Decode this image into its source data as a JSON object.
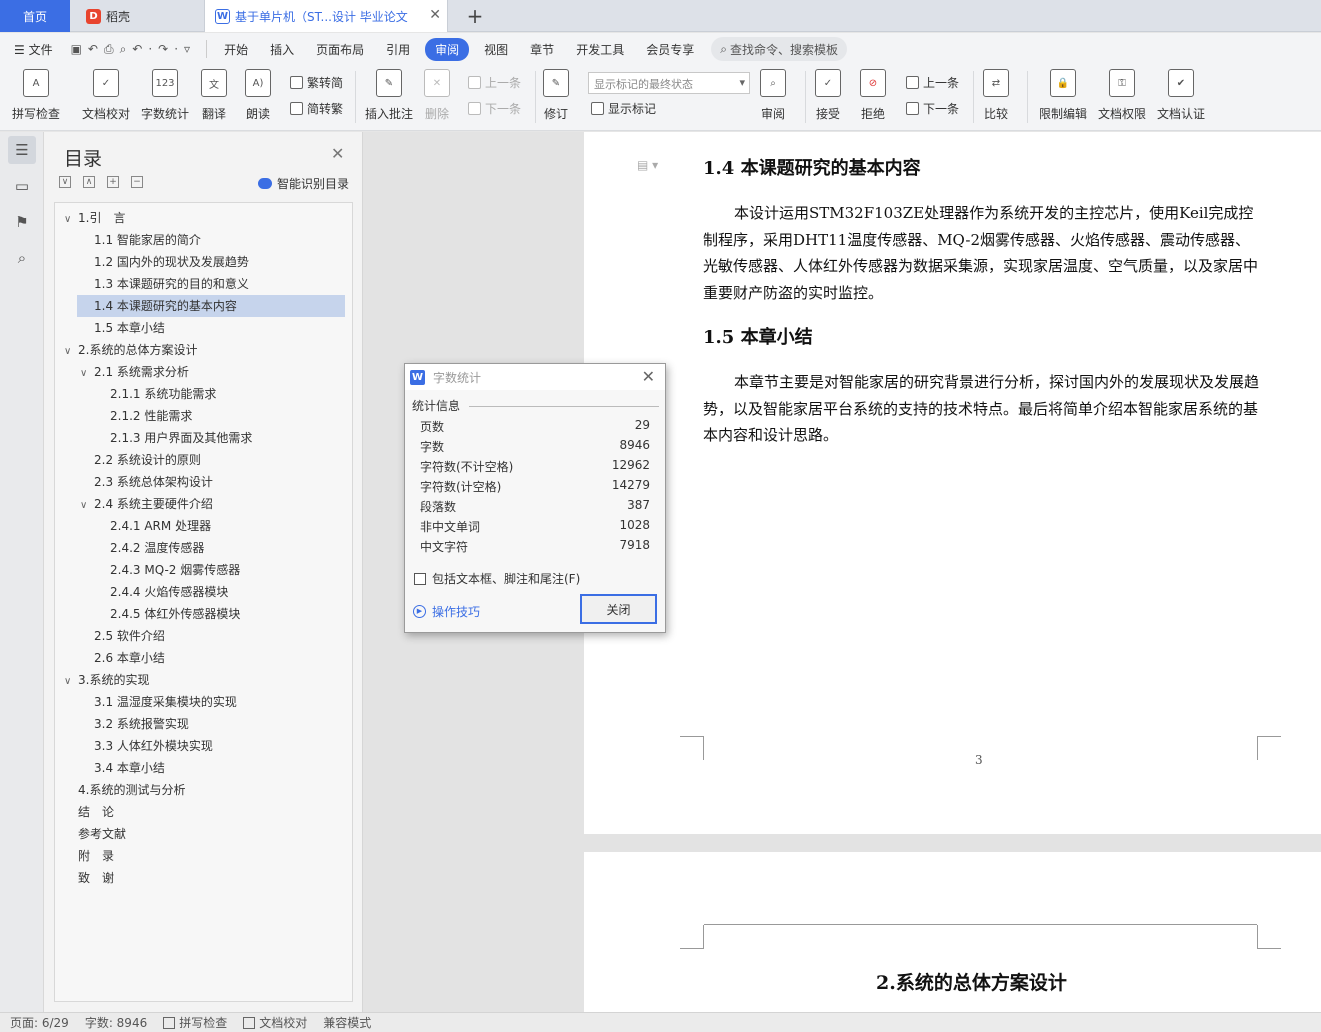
{
  "tabs": {
    "home": "首页",
    "daoke": "稻壳",
    "doc": "基于单片机（ST...设计 毕业论文",
    "add": "+"
  },
  "menu": {
    "file": "文件",
    "tabs": [
      "开始",
      "插入",
      "页面布局",
      "引用",
      "审阅",
      "视图",
      "章节",
      "开发工具",
      "会员专享"
    ],
    "active_tab": "审阅",
    "search": "查找命令、搜索模板"
  },
  "ribbon": {
    "spell": "拼写检查",
    "proof": "文档校对",
    "wordcount": "字数统计",
    "translate": "翻译",
    "read": "朗读",
    "trad": "繁转简",
    "simp": "简转繁",
    "insert_comment": "插入批注",
    "delete": "删除",
    "prev_comment": "上一条",
    "next_comment": "下一条",
    "track": "修订",
    "markup_dropdown": "显示标记的最终状态",
    "show_markup": "显示标记",
    "review": "审阅",
    "accept": "接受",
    "reject": "拒绝",
    "prev_change": "上一条",
    "next_change": "下一条",
    "compare": "比较",
    "restrict": "限制编辑",
    "permission": "文档权限",
    "certify": "文档认证"
  },
  "toc": {
    "title": "目录",
    "smart": "智能识别目录",
    "items": [
      {
        "label": "1.引　言",
        "level": 0,
        "caret": "∨"
      },
      {
        "label": "1.1  智能家居的简介",
        "level": 1
      },
      {
        "label": "1.2  国内外的现状及发展趋势",
        "level": 1
      },
      {
        "label": "1.3  本课题研究的目的和意义",
        "level": 1
      },
      {
        "label": "1.4  本课题研究的基本内容",
        "level": 1,
        "selected": true
      },
      {
        "label": "1.5  本章小结",
        "level": 1
      },
      {
        "label": "2.系统的总体方案设计",
        "level": 0,
        "caret": "∨"
      },
      {
        "label": "2.1  系统需求分析",
        "level": 1,
        "caret": "∨"
      },
      {
        "label": "2.1.1  系统功能需求",
        "level": 2
      },
      {
        "label": "2.1.2  性能需求",
        "level": 2
      },
      {
        "label": "2.1.3  用户界面及其他需求",
        "level": 2
      },
      {
        "label": "2.2  系统设计的原则",
        "level": 1
      },
      {
        "label": "2.3  系统总体架构设计",
        "level": 1
      },
      {
        "label": "2.4  系统主要硬件介绍",
        "level": 1,
        "caret": "∨"
      },
      {
        "label": "2.4.1 ARM 处理器",
        "level": 2
      },
      {
        "label": "2.4.2  温度传感器",
        "level": 2
      },
      {
        "label": "2.4.3 MQ-2 烟雾传感器",
        "level": 2
      },
      {
        "label": "2.4.4  火焰传感器模块",
        "level": 2
      },
      {
        "label": "2.4.5  体红外传感器模块",
        "level": 2
      },
      {
        "label": "2.5  软件介绍",
        "level": 1
      },
      {
        "label": "2.6  本章小结",
        "level": 1
      },
      {
        "label": "3.系统的实现",
        "level": 0,
        "caret": "∨"
      },
      {
        "label": "3.1  温湿度采集模块的实现",
        "level": 1
      },
      {
        "label": "3.2  系统报警实现",
        "level": 1
      },
      {
        "label": "3.3  人体红外模块实现",
        "level": 1
      },
      {
        "label": "3.4  本章小结",
        "level": 1
      },
      {
        "label": "4.系统的测试与分析",
        "level": 0
      },
      {
        "label": "结　论",
        "level": 0
      },
      {
        "label": "参考文献",
        "level": 0
      },
      {
        "label": "附　录",
        "level": 0
      },
      {
        "label": "致　谢",
        "level": 0
      }
    ]
  },
  "doc": {
    "h14": "1.4  本课题研究的基本内容",
    "p14": "本设计运用STM32F103ZE处理器作为系统开发的主控芯片，使用Keil完成控制程序，采用DHT11温度传感器、MQ-2烟雾传感器、火焰传感器、震动传感器、光敏传感器、人体红外传感器为数据采集源，实现家居温度、空气质量，以及家居中重要财产防盗的实时监控。",
    "h15": "1.5  本章小结",
    "p15": "本章节主要是对智能家居的研究背景进行分析，探讨国内外的发展现状及发展趋势，以及智能家居平台系统的支持的技术特点。最后将简单介绍本智能家居系统的基本内容和设计思路。",
    "page_number": "3",
    "h2": "2.系统的总体方案设计"
  },
  "dialog": {
    "title": "字数统计",
    "section": "统计信息",
    "stats": [
      {
        "label": "页数",
        "value": "29"
      },
      {
        "label": "字数",
        "value": "8946"
      },
      {
        "label": "字符数(不计空格)",
        "value": "12962"
      },
      {
        "label": "字符数(计空格)",
        "value": "14279"
      },
      {
        "label": "段落数",
        "value": "387"
      },
      {
        "label": "非中文单词",
        "value": "1028"
      },
      {
        "label": "中文字符",
        "value": "7918"
      }
    ],
    "checkbox": "包括文本框、脚注和尾注(F)",
    "tips": "操作技巧",
    "close": "关闭"
  },
  "status": {
    "page": "页面: 6/29",
    "words": "字数: 8946",
    "spell": "拼写检查",
    "proof": "文档校对",
    "compat": "兼容模式"
  },
  "colors": {
    "accent": "#3b6ee4",
    "selection": "#c6d4ec"
  }
}
